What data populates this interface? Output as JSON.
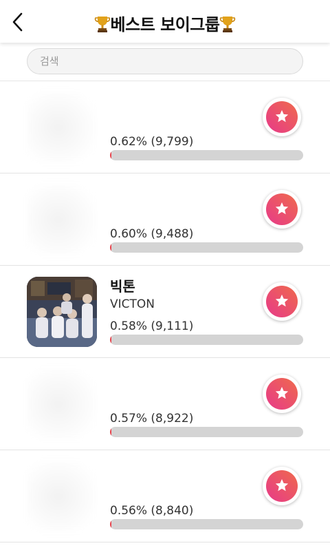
{
  "header": {
    "title": "베스트 보이그룹",
    "back_icon": "chevron-left-icon",
    "trophy_icon": "trophy-icon"
  },
  "search": {
    "placeholder": "검색",
    "value": ""
  },
  "colors": {
    "accent_start": "#e73a8a",
    "accent_end": "#ef6a4c",
    "bar_fill": "#e8404a",
    "bar_track": "#d4d4d4"
  },
  "rows": [
    {
      "name": "",
      "sub": "",
      "stat": "0.62% (9,799)",
      "percent": 0.62,
      "obscured": true
    },
    {
      "name": "",
      "sub": "",
      "stat": "0.60% (9,488)",
      "percent": 0.6,
      "obscured": true
    },
    {
      "name": "빅톤",
      "sub": "VICTON",
      "stat": "0.58% (9,111)",
      "percent": 0.58,
      "obscured": false
    },
    {
      "name": "",
      "sub": "",
      "stat": "0.57% (8,922)",
      "percent": 0.57,
      "obscured": true
    },
    {
      "name": "",
      "sub": "",
      "stat": "0.56% (8,840)",
      "percent": 0.56,
      "obscured": true
    }
  ],
  "vote_icon": "star-icon"
}
